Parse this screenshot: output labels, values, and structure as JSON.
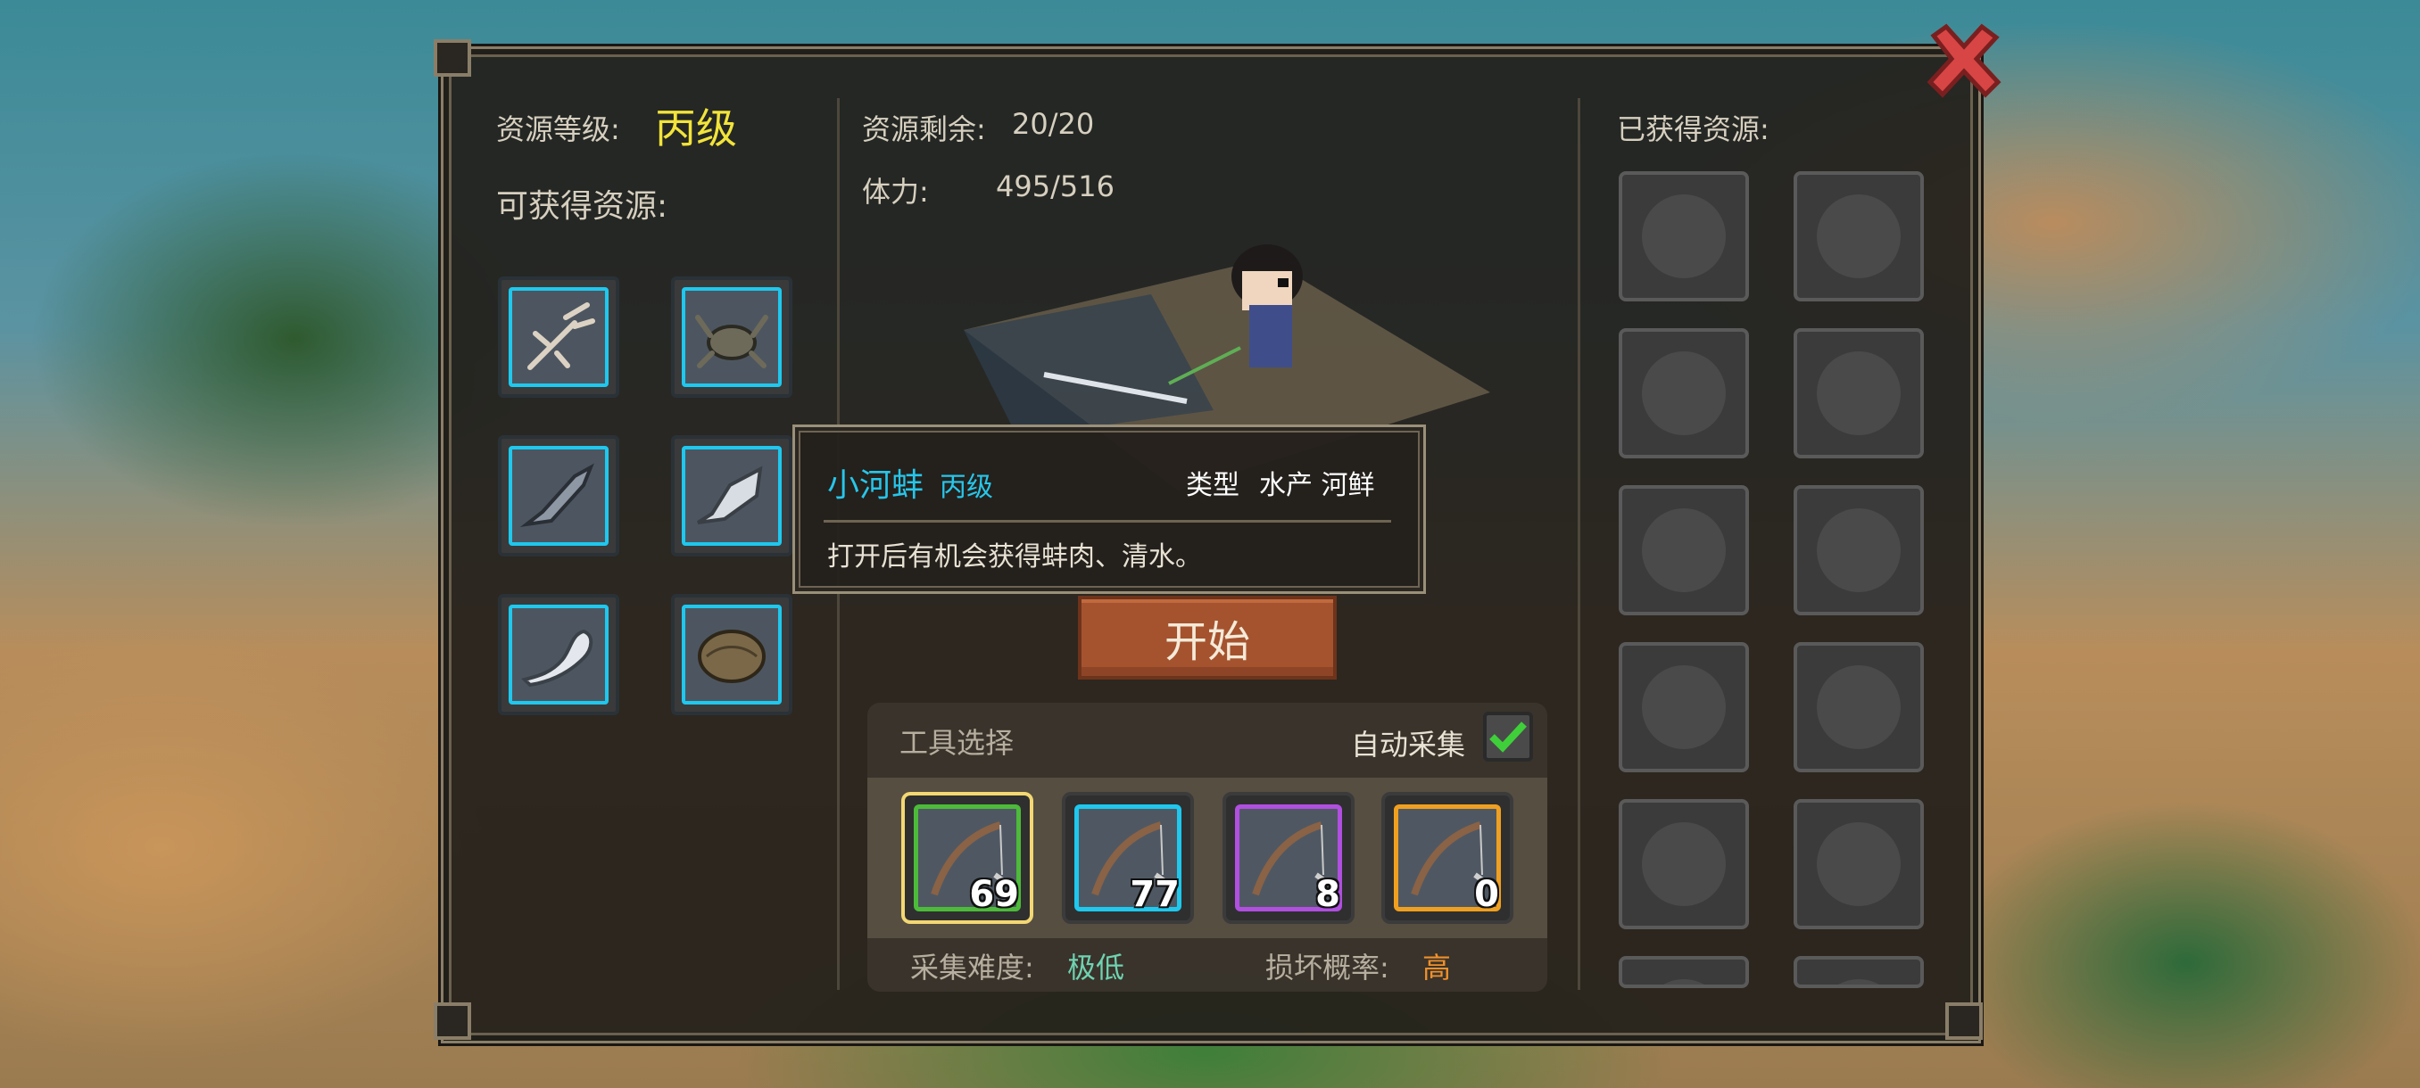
{
  "left": {
    "grade_label": "资源等级:",
    "grade_value": "丙级",
    "obtainable_label": "可获得资源:",
    "resources": [
      {
        "icon": "crayfish-icon"
      },
      {
        "icon": "crab-icon"
      },
      {
        "icon": "fish-icon"
      },
      {
        "icon": "carp-icon"
      },
      {
        "icon": "seal-fish-icon"
      },
      {
        "icon": "clam-icon"
      }
    ]
  },
  "middle": {
    "remaining_label": "资源剩余:",
    "remaining_value": "20/20",
    "stamina_label": "体力:",
    "stamina_value": "495/516",
    "start_button": "开始"
  },
  "tooltip": {
    "name": "小河蚌",
    "grade": "丙级",
    "type_label": "类型",
    "type_value": "水产 河鲜",
    "description": "打开后有机会获得蚌肉、清水。"
  },
  "tools": {
    "title": "工具选择",
    "auto_label": "自动采集",
    "auto_checked": true,
    "items": [
      {
        "icon": "fishing-rod-icon",
        "count": "69",
        "frame_color": "#4cbb3a",
        "selected": true
      },
      {
        "icon": "fishing-rod-icon",
        "count": "77",
        "frame_color": "#1ec8ee",
        "selected": false
      },
      {
        "icon": "fishing-rod-icon",
        "count": "8",
        "frame_color": "#b04fe0",
        "selected": false
      },
      {
        "icon": "fishing-rod-icon",
        "count": "0",
        "frame_color": "#f0a020",
        "selected": false
      }
    ],
    "difficulty_label": "采集难度:",
    "difficulty_value": "极低",
    "break_label": "损坏概率:",
    "break_value": "高"
  },
  "right": {
    "obtained_label": "已获得资源:"
  },
  "colors": {
    "grade": "#f2e33a",
    "cyan": "#27c6ea",
    "difficulty": "#6fd2b0",
    "break": "#f0902a"
  }
}
